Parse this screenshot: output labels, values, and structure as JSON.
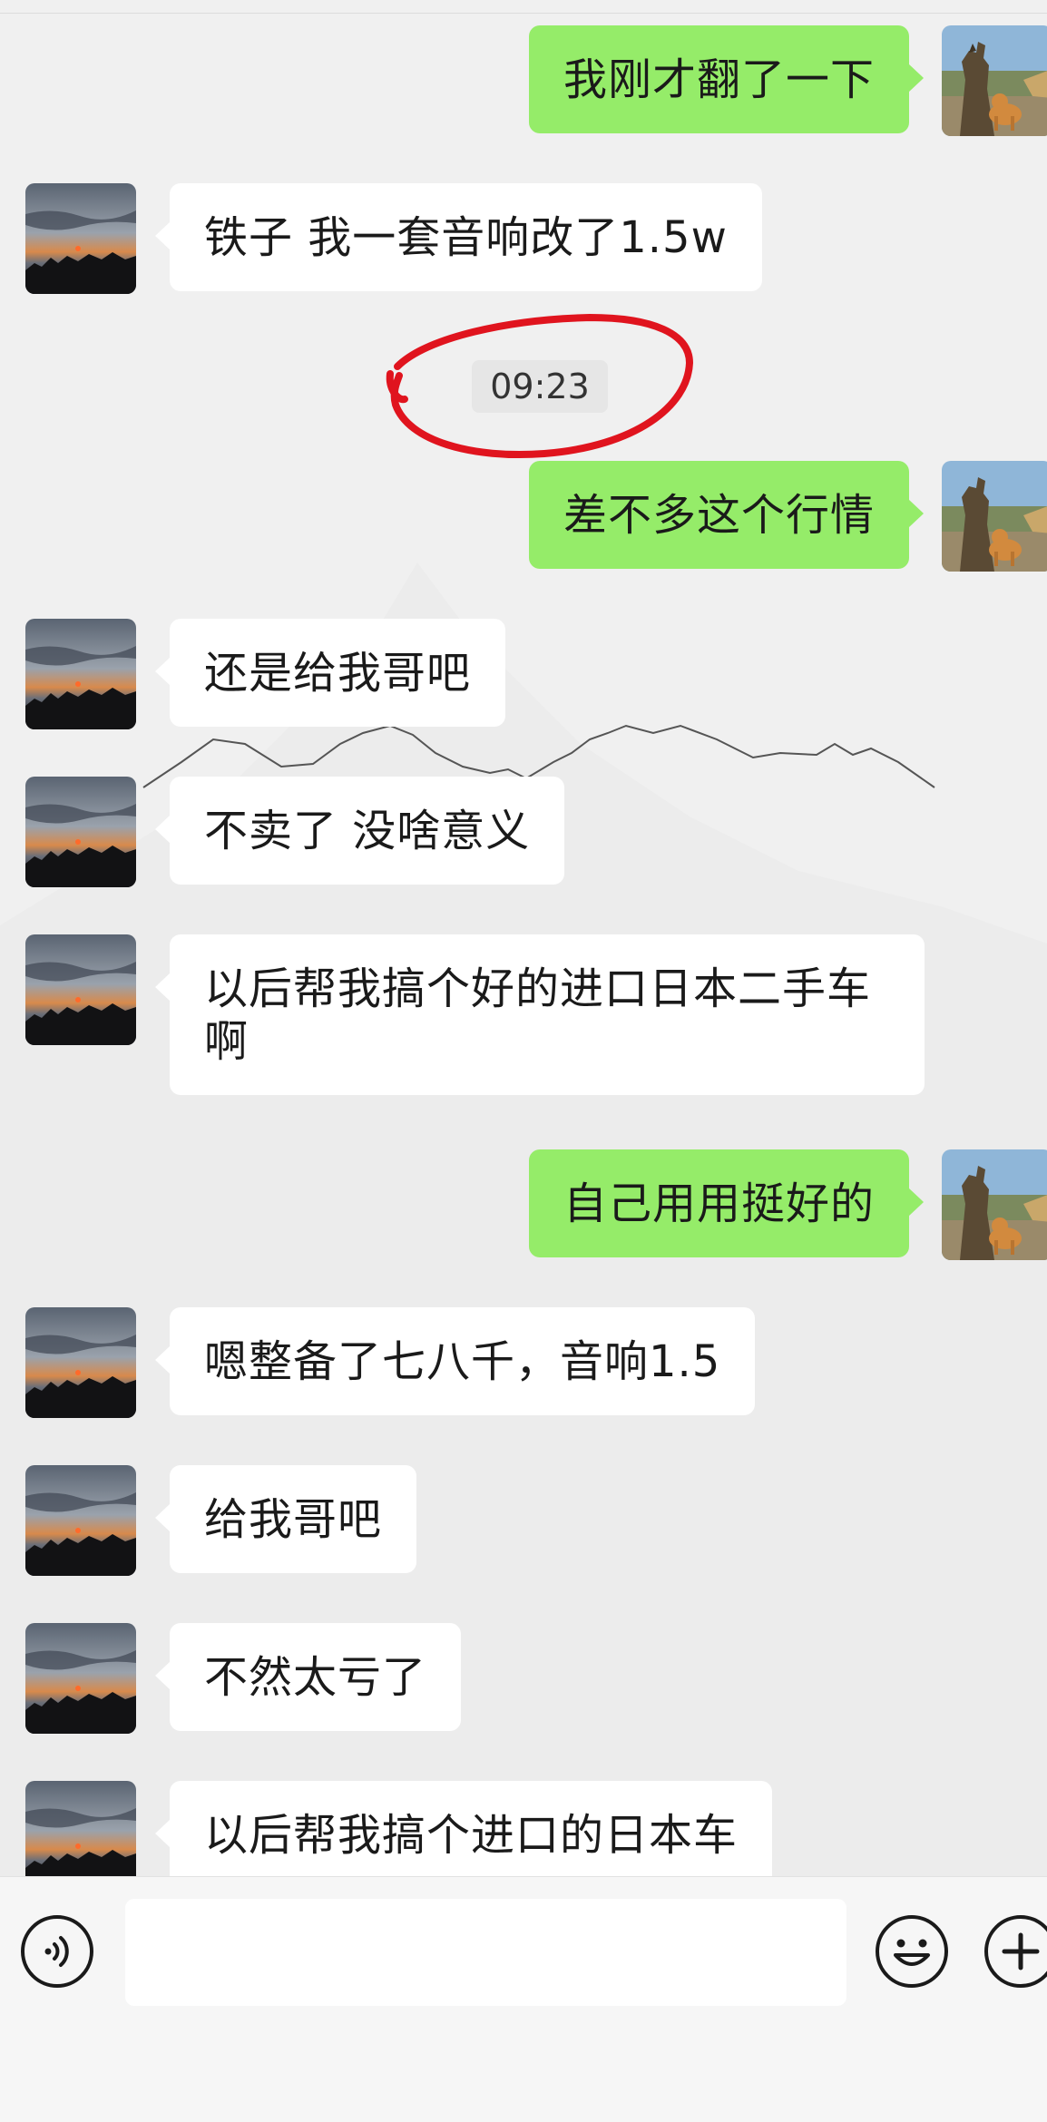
{
  "timestamp": "09:23",
  "messages": [
    {
      "side": "right",
      "text": "我刚才翻了一下"
    },
    {
      "side": "left",
      "text": "铁子 我一套音响改了1.5w"
    },
    {
      "side": "right",
      "text": "差不多这个行情"
    },
    {
      "side": "left",
      "text": "还是给我哥吧"
    },
    {
      "side": "left",
      "text": "不卖了 没啥意义"
    },
    {
      "side": "left",
      "text": "以后帮我搞个好的进口日本二手车啊"
    },
    {
      "side": "right",
      "text": "自己用用挺好的"
    },
    {
      "side": "left",
      "text": "嗯整备了七八千，音响1.5"
    },
    {
      "side": "left",
      "text": "给我哥吧"
    },
    {
      "side": "left",
      "text": "不然太亏了"
    },
    {
      "side": "left",
      "text": "以后帮我搞个进口的日本车"
    }
  ],
  "input_bar": {
    "message_value": "",
    "voice_icon": "voice-icon",
    "emoji_icon": "emoji-icon",
    "plus_icon": "plus-icon"
  },
  "colors": {
    "sent_bubble": "#95ec69",
    "received_bubble": "#ffffff",
    "chat_background": "#f0f0f0",
    "annotation_circle": "#e0141e"
  }
}
